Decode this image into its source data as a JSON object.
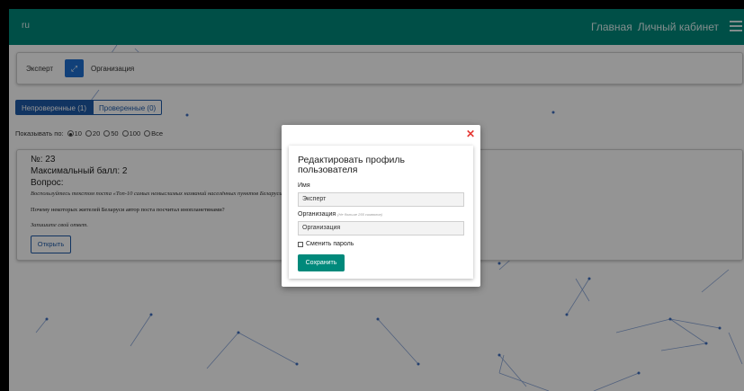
{
  "header": {
    "brand": "ru",
    "nav": [
      "Главная",
      "Личный кабинет"
    ],
    "menu_icon": "hamburger-menu-icon",
    "background_color": "#00897b"
  },
  "role_bar": {
    "left_label": "Эксперт",
    "switch_icon": "expand-arrows-icon",
    "right_label": "Организация"
  },
  "tabs": [
    {
      "label": "Непроверенные (1)",
      "active": true
    },
    {
      "label": "Проверенные (0)",
      "active": false
    }
  ],
  "show_by": {
    "label": "Показывать по:",
    "options": [
      "10",
      "20",
      "50",
      "100",
      "Все"
    ],
    "selected": "10"
  },
  "task": {
    "number": "№: 23",
    "max_score": "Максимальный балл: 2",
    "question_label": "Вопрос:",
    "instruction": "Воспользуйтесь текстом поста «Топ-10 самых немыслимых названий населённых пунктов Беларуси»",
    "question": "Почему некоторых жителей Беларуси автор поста посчитал инопланетянами?",
    "answer_hint": "Запишите свой ответ.",
    "open_button": "Открыть"
  },
  "modal": {
    "close_icon": "close-icon",
    "title": "Редактировать профиль пользователя",
    "name_label": "Имя",
    "name_value": "Эксперт",
    "org_label": "Организация",
    "org_hint": "(Не больше 255 символов)",
    "org_value": "Организация",
    "change_password_label": "Сменить пароль",
    "change_password_checked": false,
    "save_button": "Сохранить",
    "accent_color": "#00897b"
  }
}
